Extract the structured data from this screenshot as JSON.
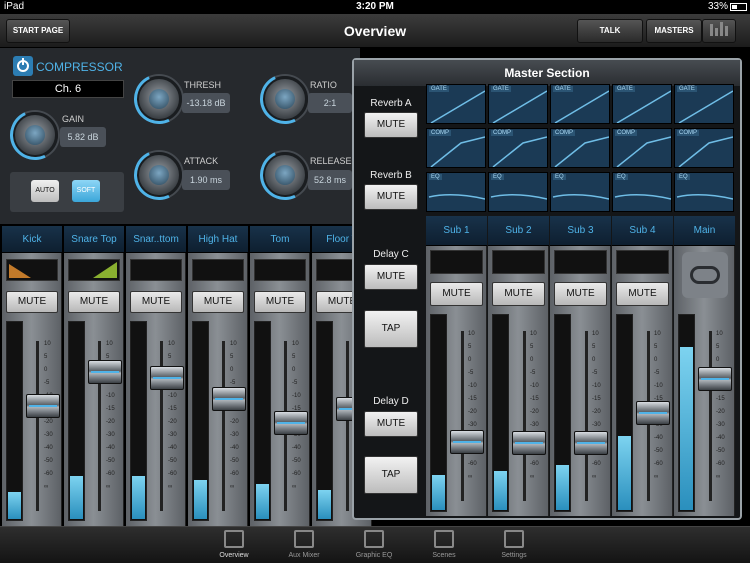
{
  "status": {
    "device": "iPad",
    "time": "3:20 PM",
    "battery": "33%"
  },
  "nav": {
    "start_label": "START PAGE",
    "title": "Overview",
    "talk_label": "TALK",
    "masters_label": "MASTERS"
  },
  "compressor": {
    "title": "COMPRESSOR",
    "channel": "Ch. 6",
    "gain_label": "GAIN",
    "gain_value": "5.82 dB",
    "thresh_label": "THRESH",
    "thresh_value": "-13.18 dB",
    "ratio_label": "RATIO",
    "ratio_value": "2:1",
    "attack_label": "ATTACK",
    "attack_value": "1.90 ms",
    "release_label": "RELEASE",
    "release_value": "52.8 ms",
    "auto_label": "AUTO",
    "soft_label": "SOFT"
  },
  "channels": [
    {
      "name": "Kick",
      "mute": "MUTE",
      "level": 0.14,
      "fader": 0.62
    },
    {
      "name": "Snare Top",
      "mute": "MUTE",
      "level": 0.22,
      "fader": 0.82
    },
    {
      "name": "Snar..ttom",
      "mute": "MUTE",
      "level": 0.22,
      "fader": 0.78
    },
    {
      "name": "High Hat",
      "mute": "MUTE",
      "level": 0.2,
      "fader": 0.66
    },
    {
      "name": "Tom",
      "mute": "MUTE",
      "level": 0.18,
      "fader": 0.52
    },
    {
      "name": "Floor T",
      "mute": "MUTE",
      "level": 0.15,
      "fader": 0.6
    }
  ],
  "scale_labels": [
    "10",
    "5",
    "0",
    "-5",
    "-10",
    "-15",
    "-20",
    "-30",
    "-40",
    "-50",
    "-60",
    "∞"
  ],
  "master": {
    "title": "Master Section",
    "fx": [
      {
        "name": "Reverb A",
        "mute": "MUTE"
      },
      {
        "name": "Reverb B",
        "mute": "MUTE"
      },
      {
        "name": "Delay C",
        "mute": "MUTE",
        "tap": "TAP"
      },
      {
        "name": "Delay D",
        "mute": "MUTE",
        "tap": "TAP"
      }
    ],
    "tags": {
      "gate": "GATE",
      "comp": "COMP",
      "eq": "EQ"
    },
    "subs": [
      {
        "name": "Sub 1",
        "mute": "MUTE",
        "level": 0.18,
        "fader": 0.35
      },
      {
        "name": "Sub 2",
        "mute": "MUTE",
        "level": 0.2,
        "fader": 0.34
      },
      {
        "name": "Sub 3",
        "mute": "MUTE",
        "level": 0.23,
        "fader": 0.34
      },
      {
        "name": "Sub 4",
        "mute": "MUTE",
        "level": 0.38,
        "fader": 0.52
      }
    ],
    "main": {
      "name": "Main",
      "level": 0.84,
      "fader": 0.72
    }
  },
  "tabs": [
    "Overview",
    "Aux Mixer",
    "Graphic EQ",
    "Scenes",
    "Settings"
  ],
  "colors": {
    "accent": "#4fb3e8",
    "meter": "#7dd3f0"
  }
}
